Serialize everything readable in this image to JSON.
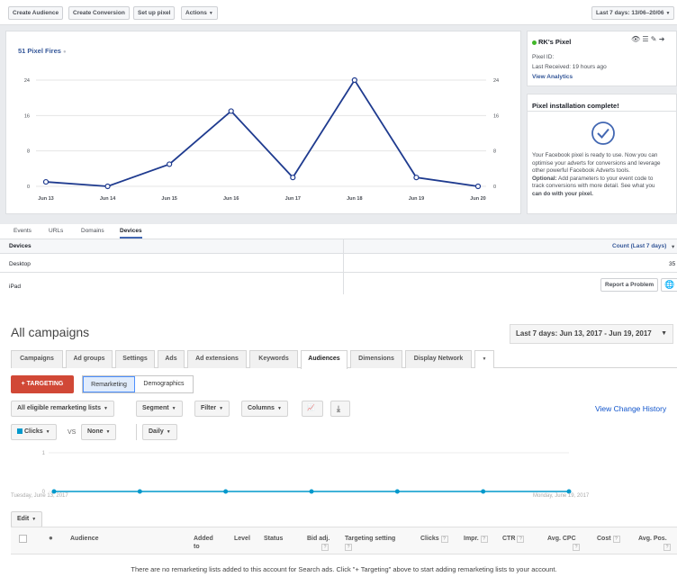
{
  "fb": {
    "toolbar": {
      "create_audience": "Create Audience",
      "create_conversion": "Create Conversion",
      "setup_pixel": "Set up pixel",
      "actions": "Actions",
      "date_range": "Last 7 days: 13/06–20/06"
    },
    "chart_title": "51 Pixel Fires",
    "pixel_panel": {
      "name": "RK's Pixel",
      "pixel_id_label": "Pixel ID:",
      "last_received": "Last Received: 19 hours ago",
      "view_analytics": "View Analytics"
    },
    "install_panel": {
      "title": "Pixel installation complete!",
      "body": [
        "Your Facebook pixel is ready to use. Now you can",
        "optimise your adverts for conversions and leverage",
        "other powerful Facebook Adverts tools."
      ],
      "optional_label": "Optional:",
      "optional_body": [
        " Add parameters to your event code to",
        "track conversions with more detail. See what you",
        "can do with your pixel."
      ]
    },
    "tabs": [
      "Events",
      "URLs",
      "Domains",
      "Devices"
    ],
    "table": {
      "col_devices": "Devices",
      "col_count": "Count (Last 7 days)",
      "rows": [
        {
          "device": "Desktop",
          "count": "35"
        },
        {
          "device": "iPad",
          "count": ""
        }
      ],
      "report_problem": "Report a Problem"
    }
  },
  "gads": {
    "title": "All campaigns",
    "date_range": "Last 7 days: Jun 13, 2017 - Jun 19, 2017",
    "tabs": [
      "Campaigns",
      "Ad groups",
      "Settings",
      "Ads",
      "Ad extensions",
      "Keywords",
      "Audiences",
      "Dimensions",
      "Display Network"
    ],
    "targeting": "+ TARGETING",
    "remarketing": "Remarketing",
    "demographics": "Demographics",
    "filters": {
      "lists": "All eligible remarketing lists",
      "segment": "Segment",
      "filter": "Filter",
      "columns": "Columns"
    },
    "view_change_history": "View Change History",
    "metric1": "Clicks",
    "vs": "VS",
    "metric2": "None",
    "period": "Daily",
    "chart_start": "Tuesday, June 13, 2017",
    "chart_end": "Monday, June 19, 2017",
    "edit": "Edit",
    "columns": [
      "Audience",
      "Added to",
      "Level",
      "Status",
      "Bid adj.",
      "Targeting setting",
      "Clicks",
      "Impr.",
      "CTR",
      "Avg. CPC",
      "Cost",
      "Avg. Pos."
    ],
    "empty_message": "There are no remarketing lists added to this account for Search ads. Click \"+ Targeting\" above to start adding remarketing lists to your account."
  },
  "chart_data": [
    {
      "type": "line",
      "title": "51 Pixel Fires",
      "categories": [
        "Jun 13",
        "Jun 14",
        "Jun 15",
        "Jun 16",
        "Jun 17",
        "Jun 18",
        "Jun 19",
        "Jun 20"
      ],
      "series": [
        {
          "values": [
            1,
            0,
            5,
            17,
            2,
            24,
            2,
            0
          ]
        }
      ],
      "yticks": [
        "0",
        "8",
        "16",
        "24"
      ],
      "ylim": [
        0,
        24
      ],
      "color": "#1f3b8f",
      "grid": true
    },
    {
      "type": "line",
      "categories": [
        "Tuesday, June 13, 2017",
        "",
        "",
        "",
        "",
        "",
        "Monday, June 19, 2017"
      ],
      "series": [
        {
          "name": "Clicks",
          "values": [
            0,
            0,
            0,
            0,
            0,
            0,
            0
          ]
        }
      ],
      "yticks": [
        "0",
        "1"
      ],
      "ylim": [
        0,
        1
      ],
      "color": "#0099cc"
    }
  ]
}
